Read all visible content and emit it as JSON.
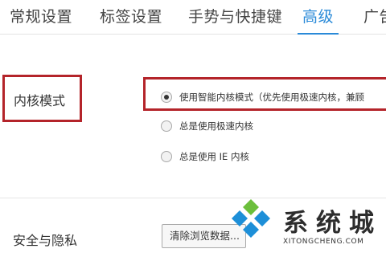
{
  "tabs": [
    {
      "label": "常规设置"
    },
    {
      "label": "标签设置"
    },
    {
      "label": "手势与快捷键"
    },
    {
      "label": "高级",
      "active": true
    },
    {
      "label": "广告"
    }
  ],
  "kernel": {
    "label": "内核模式",
    "options": [
      {
        "label": "使用智能内核模式（优先使用极速内核，兼顾",
        "checked": true
      },
      {
        "label": "总是使用极速内核",
        "checked": false
      },
      {
        "label": "总是使用 IE 内核",
        "checked": false
      }
    ]
  },
  "privacy": {
    "label": "安全与隐私",
    "clear_button": "清除浏览数据..."
  },
  "watermark": {
    "brand": "系统城",
    "url": "XITONGCHENG.COM"
  },
  "colors": {
    "accent": "#2a8ad8",
    "highlight_box": "#b4242a",
    "watermark_green": "#6cbf3c",
    "watermark_blue": "#1d8fd8"
  }
}
